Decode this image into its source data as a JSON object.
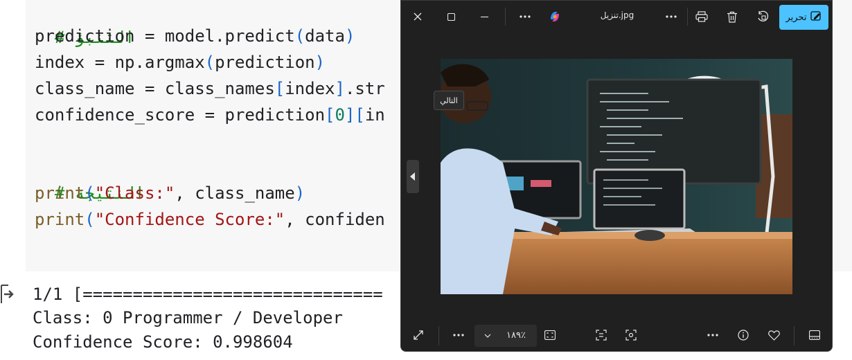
{
  "code": {
    "comment1": "# التنبؤ",
    "line1": {
      "lhs": "prediction = model.predict",
      "p_open": "(",
      "arg": "data",
      "p_close": ")"
    },
    "line2": {
      "lhs": "index = np.argmax",
      "p_open": "(",
      "arg": "prediction",
      "p_close": ")"
    },
    "line3": {
      "lhs": "class_name = class_names",
      "b_open": "[",
      "arg": "index",
      "b_close": "]",
      "rest": ".str"
    },
    "line4": {
      "lhs": "confidence_score = prediction",
      "b1": "[",
      "zero": "0",
      "b2": "]",
      "b3": "[",
      "rest": "in"
    },
    "comment2": "# النتيجة",
    "line5": {
      "fn": "print",
      "p_open": "(",
      "str": "\"Class:\"",
      "rest": ", class_name",
      "p_close": ")"
    },
    "line6": {
      "fn": "print",
      "p_open": "(",
      "str": "\"Confidence Score:\"",
      "rest": ", confiden"
    }
  },
  "output": {
    "progress": "1/1 [==============================",
    "class_line": "Class: 0 Programmer / Developer",
    "score_line": "Confidence Score: 0.998604",
    "icon": "output-arrow-icon"
  },
  "viewer": {
    "title": "تنزيل.jpg",
    "edit_label": "تحرير",
    "tooltip": "التالي",
    "zoom": "١٨٩٪",
    "colors": {
      "accent": "#4cc2ff",
      "background": "#202020"
    }
  }
}
